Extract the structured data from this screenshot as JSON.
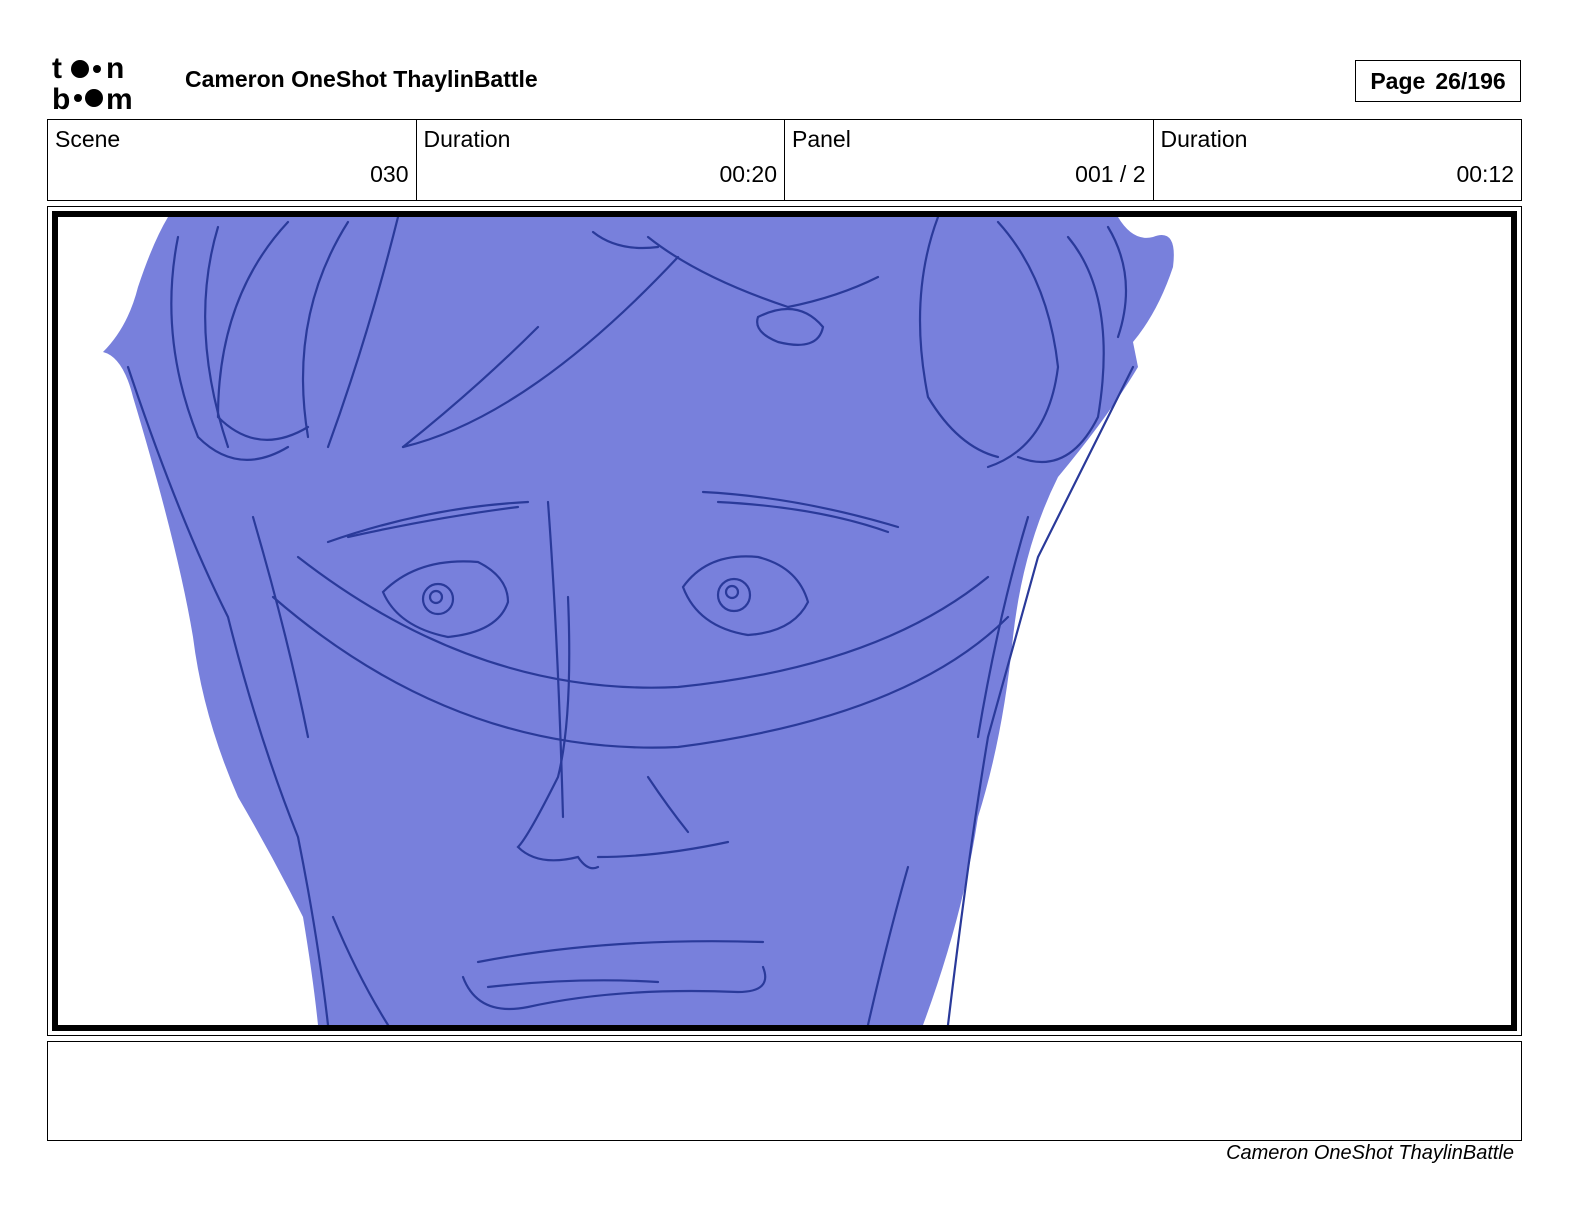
{
  "header": {
    "logo_text": "toon boom",
    "title": "Cameron OneShot ThaylinBattle",
    "page_label": "Page",
    "page_value": "26/196"
  },
  "info": {
    "scene_label": "Scene",
    "scene_value": "030",
    "scene_duration_label": "Duration",
    "scene_duration_value": "00:20",
    "panel_label": "Panel",
    "panel_value": "001 / 2",
    "panel_duration_label": "Duration",
    "panel_duration_value": "00:12"
  },
  "colors": {
    "sketch_fill": "#7880dc",
    "sketch_line": "#2a3a9a"
  },
  "notes": {
    "text": ""
  },
  "footer": {
    "text": "Cameron OneShot ThaylinBattle"
  }
}
